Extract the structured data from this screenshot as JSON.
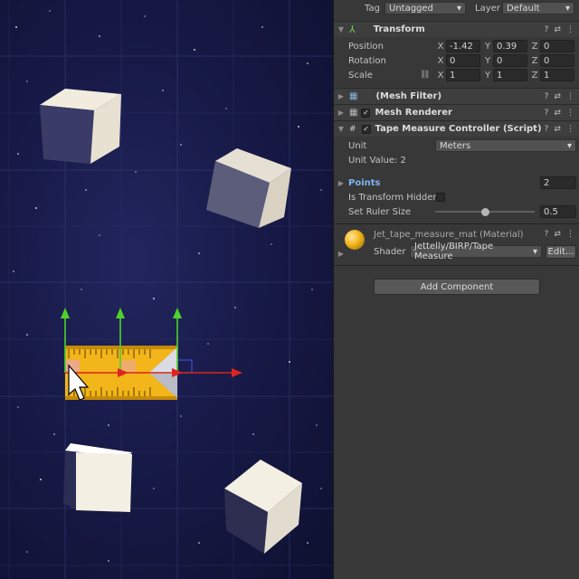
{
  "gameobject": {
    "tag_label": "Tag",
    "tag_value": "Untagged",
    "layer_label": "Layer",
    "layer_value": "Default"
  },
  "transform": {
    "title": "Transform",
    "position_label": "Position",
    "rotation_label": "Rotation",
    "scale_label": "Scale",
    "axes": [
      "X",
      "Y",
      "Z"
    ],
    "position": [
      "-1.42",
      "0.39",
      "0"
    ],
    "rotation": [
      "0",
      "0",
      "0"
    ],
    "scale": [
      "1",
      "1",
      "1"
    ]
  },
  "mesh_filter": {
    "title": "(Mesh Filter)"
  },
  "mesh_renderer": {
    "title": "Mesh Renderer"
  },
  "tape_controller": {
    "title": "Tape Measure Controller (Script)",
    "unit_label": "Unit",
    "unit_value": "Meters",
    "unit_value_text": "Unit Value: 2",
    "points_label": "Points",
    "points_count": "2",
    "hidden_label": "Is Transform Hidden?",
    "ruler_label": "Set Ruler Size",
    "ruler_value": "0.5",
    "ruler_fraction": 0.5
  },
  "material": {
    "title": "Jet_tape_measure_mat (Material)",
    "shader_label": "Shader",
    "shader_value": "Jettelly/BIRP/Tape Measure",
    "edit_label": "Edit..."
  },
  "add_component_label": "Add Component",
  "colors": {
    "tape_yellow": "#f2b51a",
    "gizmo_green": "#4fd12b",
    "gizmo_red": "#e0231d",
    "inspector_bg": "#383838"
  }
}
